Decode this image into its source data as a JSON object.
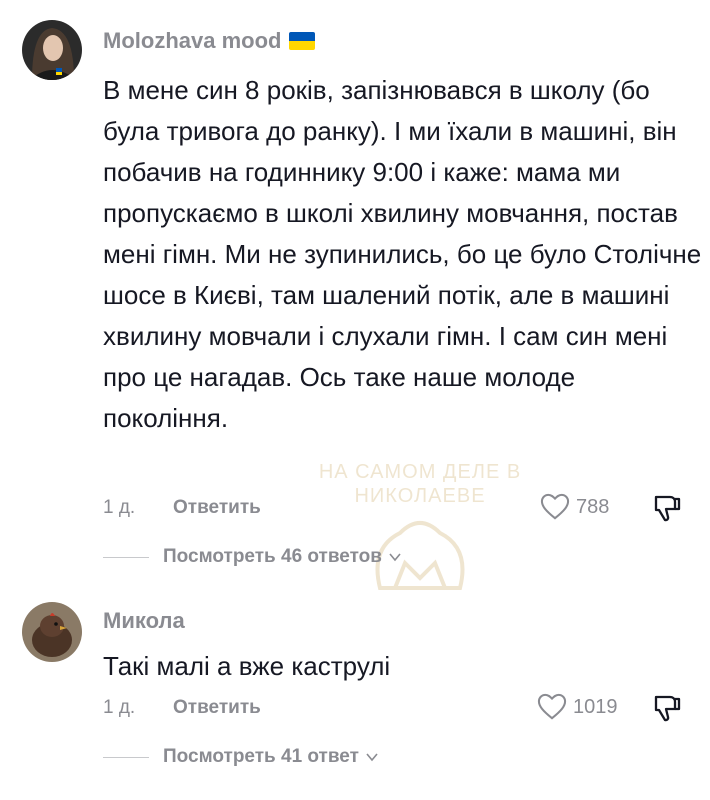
{
  "watermark": {
    "line1": "НА САМОМ ДЕЛЕ В",
    "line2": "НИКОЛАЕВЕ"
  },
  "comments": [
    {
      "username": "Molozhava mood",
      "has_flag": true,
      "text": "В мене син 8 років, запізнювався в школу (бо була тривога до ранку). І ми їхали в машині, він побачив на годиннику 9:00 і каже: мама ми пропускаємо в школі хвилину мовчання, постав мені гімн. Ми не зупинились, бо це було Столічне шосе в Києві, там шалений потік, але в машині хвилину мовчали і слухали гімн. І сам син мені про це нагадав. Ось таке наше молоде покоління.",
      "time": "1 д.",
      "reply_label": "Ответить",
      "likes": "788",
      "view_replies": "Посмотреть 46 ответов"
    },
    {
      "username": "Микола",
      "has_flag": false,
      "text": "Такі малі а вже каструлі",
      "time": "1 д.",
      "reply_label": "Ответить",
      "likes": "1019",
      "view_replies": "Посмотреть 41 ответ"
    }
  ],
  "icons": {
    "like": "heart-outline-icon",
    "dislike": "thumbs-down-icon",
    "expand": "chevron-down-icon"
  },
  "colors": {
    "text": "#161823",
    "secondary": "#8a8b91",
    "flag_blue": "#0057b7",
    "flag_yellow": "#ffd700"
  }
}
